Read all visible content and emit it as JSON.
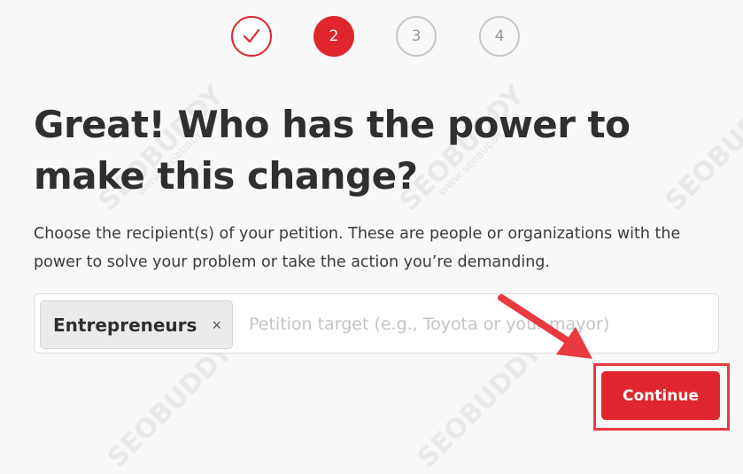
{
  "steps": [
    {
      "state": "done",
      "icon": "checkmark-icon"
    },
    {
      "state": "active",
      "label": "2"
    },
    {
      "state": "todo",
      "label": "3"
    },
    {
      "state": "todo",
      "label": "4"
    }
  ],
  "heading": "Great! Who has the power to make this change?",
  "description": "Choose the recipient(s) of your petition. These are people or organizations with the power to solve your problem or take the action you’re demanding.",
  "target_field": {
    "chips": [
      {
        "label": "Entrepreneurs",
        "remove_symbol": "×"
      }
    ],
    "placeholder": "Petition target (e.g., Toyota or your mayor)",
    "value": ""
  },
  "continue_label": "Continue",
  "watermark": {
    "text": "SEOBUDDY",
    "subtext": "WWW.SEOBUDDY.COM"
  },
  "colors": {
    "accent": "#e0262d",
    "annotation": "#e83a3f",
    "inactive": "#c8c8c8"
  }
}
